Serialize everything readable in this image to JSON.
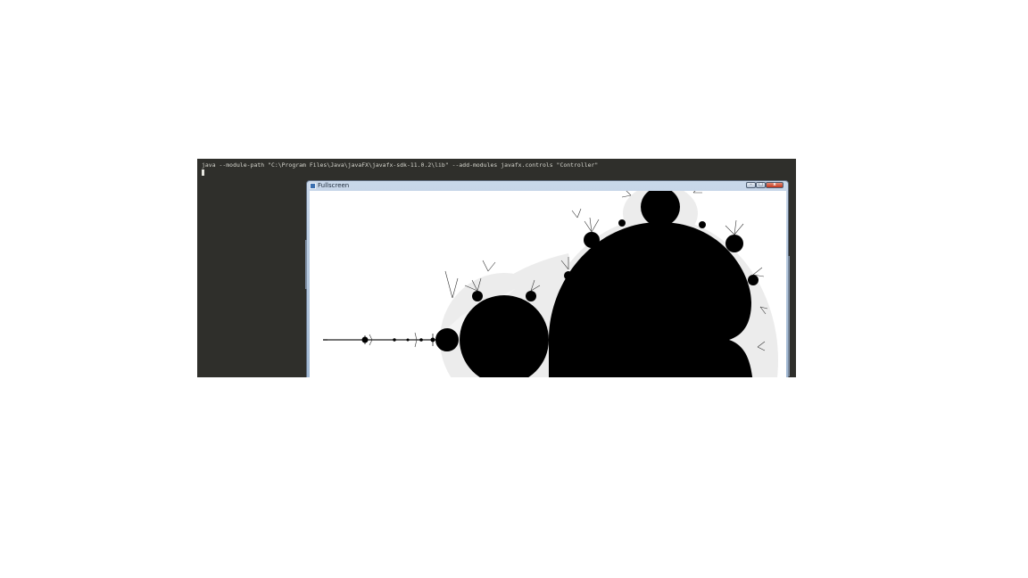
{
  "terminal": {
    "command": "java --module-path \"C:\\Program Files\\Java\\javaFX\\javafx-sdk-11.0.2\\lib\" --add-modules javafx.controls \"Controller\""
  },
  "window": {
    "title": "Fullscreen",
    "minimize_label": "",
    "maximize_label": "",
    "close_label": "x"
  },
  "fractal": {
    "name": "mandelbrot-set",
    "foreground_color": "#000000",
    "background_color": "#ffffff",
    "halo_color": "#d9d9d9"
  }
}
